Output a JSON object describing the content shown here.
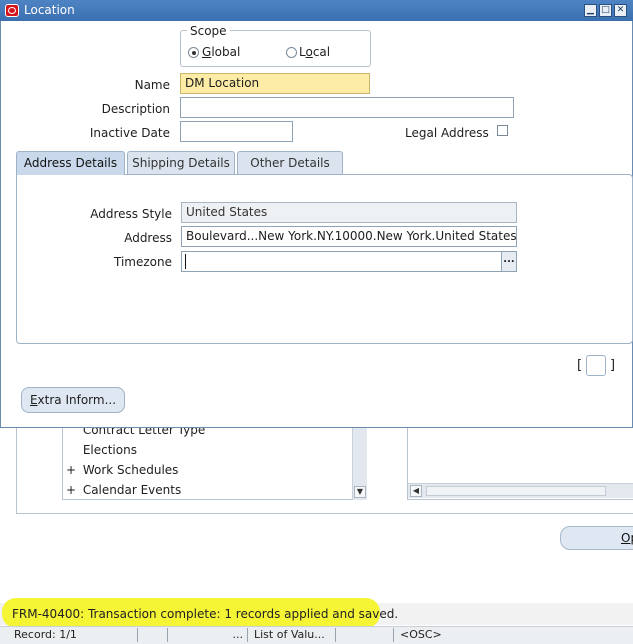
{
  "window": {
    "title": "Location"
  },
  "scope": {
    "title": "Scope",
    "options": [
      {
        "label_u": "G",
        "label_rest": "lobal",
        "selected": true
      },
      {
        "label_pre": "L",
        "label_u": "o",
        "label_rest": "cal",
        "selected": false
      }
    ]
  },
  "form": {
    "name_label": "Name",
    "name_value": "DM Location",
    "description_label": "Description",
    "description_value": "",
    "inactive_date_label": "Inactive Date",
    "inactive_date_value": "",
    "legal_address_label": "Legal Address",
    "legal_address_checked": false
  },
  "tabs": [
    {
      "label": "Address Details",
      "active": true
    },
    {
      "label": "Shipping Details",
      "active": false
    },
    {
      "label": "Other Details",
      "active": false
    }
  ],
  "address": {
    "style_label": "Address Style",
    "style_value": "United States",
    "address_label": "Address",
    "address_value": "Boulevard...New York.NY.10000.New York.United States.",
    "timezone_label": "Timezone",
    "timezone_value": "",
    "lov_button": "..."
  },
  "bracket": {
    "open": "[",
    "close": "]"
  },
  "buttons": {
    "extra_inform": "Extra Inform..."
  },
  "background_navigator": {
    "items": [
      {
        "expander": "",
        "label": "Contract Letter Type"
      },
      {
        "expander": "",
        "label": "Elections"
      },
      {
        "expander": "+",
        "label": "Work Schedules"
      },
      {
        "expander": "+",
        "label": "Calendar Events"
      }
    ],
    "open_button": "Op"
  },
  "status": {
    "message": "FRM-40400: Transaction complete: 1 records applied and saved.",
    "record": "Record: 1/1",
    "seg_dots": "...",
    "list_of_values": "List of Valu...",
    "osc": "<OSC>",
    "highlight_color": "#f4f32a"
  }
}
